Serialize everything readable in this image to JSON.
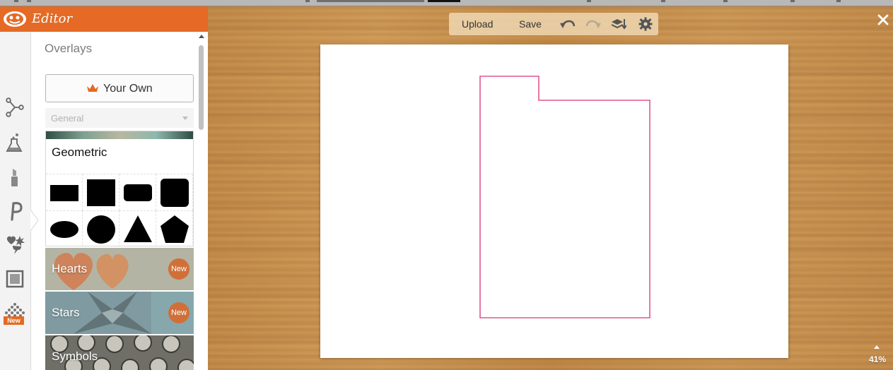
{
  "app": {
    "title": "Editor"
  },
  "rail": {
    "icons": [
      "effects-icon",
      "lab-icon",
      "lipstick-icon",
      "text-icon",
      "overlays-icon",
      "frames-icon",
      "textures-icon"
    ],
    "new_badge": "New"
  },
  "panel": {
    "title": "Overlays",
    "your_own_label": "Your Own",
    "dropdown_value": "General",
    "geometric_title": "Geometric",
    "shapes": [
      "rectangle",
      "square",
      "rounded-rectangle",
      "rounded-square",
      "ellipse",
      "circle",
      "triangle",
      "pentagon"
    ],
    "categories": [
      {
        "label": "Hearts",
        "badge": "New"
      },
      {
        "label": "Stars",
        "badge": "New"
      },
      {
        "label": "Symbols",
        "badge": ""
      }
    ]
  },
  "toolbar": {
    "upload_label": "Upload",
    "save_label": "Save",
    "icons": [
      "undo-icon",
      "redo-icon",
      "layers-icon",
      "settings-icon"
    ]
  },
  "workspace": {
    "zoom": "41%",
    "overlay_stroke_color": "#e0578f"
  },
  "colors": {
    "brand": "#e46a25",
    "badge": "#d07038",
    "canvas": "#ffffff"
  }
}
